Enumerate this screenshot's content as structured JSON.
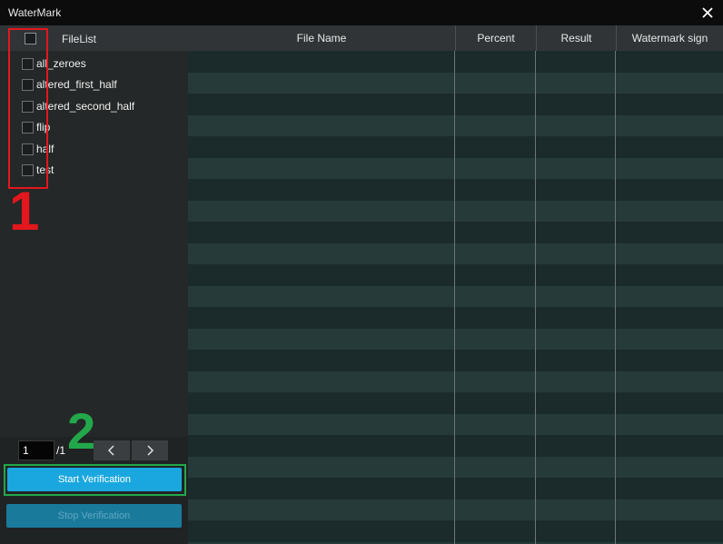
{
  "window": {
    "title": "WaterMark"
  },
  "icons": {
    "close": "close-icon",
    "prev": "chevron-left-icon",
    "next": "chevron-right-icon"
  },
  "file_list": {
    "header_label": "FileList",
    "items": [
      "all_zeroes",
      "altered_first_half",
      "altered_second_half",
      "flip",
      "half",
      "test"
    ]
  },
  "pagination": {
    "current_page": "1",
    "total_label": "/1"
  },
  "buttons": {
    "start": "Start Verification",
    "stop": "Stop Verification"
  },
  "table": {
    "columns": [
      "File Name",
      "Percent",
      "Result",
      "Watermark sign"
    ]
  },
  "annotations": {
    "marker_1": "1",
    "marker_2": "2"
  },
  "colors": {
    "accent": "#1aa7e0",
    "annotation_red": "#e3171d",
    "annotation_green": "#22a84a"
  }
}
